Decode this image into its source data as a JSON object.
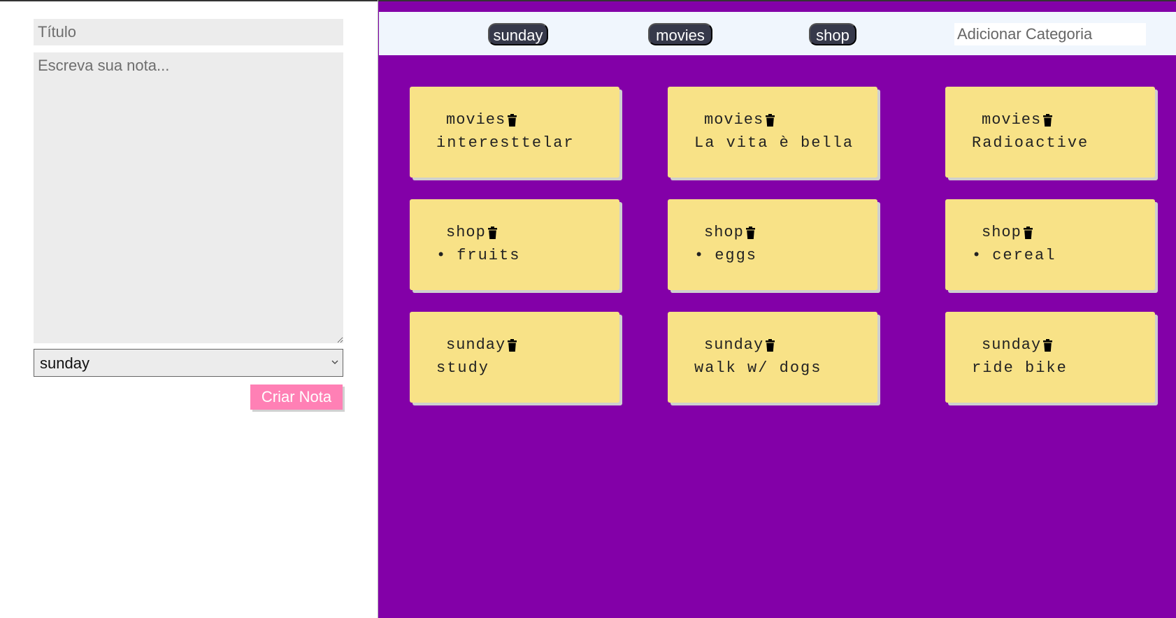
{
  "form": {
    "title_placeholder": "Título",
    "note_placeholder": "Escreva sua nota...",
    "selected_category": "sunday",
    "category_options": [
      "sunday",
      "movies",
      "shop"
    ],
    "create_button_label": "Criar Nota"
  },
  "category_bar": {
    "categories": [
      "sunday",
      "movies",
      "shop"
    ],
    "add_placeholder": "Adicionar Categoria"
  },
  "notes": [
    {
      "category": "movies",
      "text": "interesttelar",
      "bullet": false
    },
    {
      "category": "movies",
      "text": "La vita è bella",
      "bullet": false
    },
    {
      "category": "movies",
      "text": "Radioactive",
      "bullet": false
    },
    {
      "category": "shop",
      "text": "fruits",
      "bullet": true
    },
    {
      "category": "shop",
      "text": "eggs",
      "bullet": true
    },
    {
      "category": "shop",
      "text": "cereal",
      "bullet": true
    },
    {
      "category": "sunday",
      "text": "study",
      "bullet": false
    },
    {
      "category": "sunday",
      "text": "walk w/ dogs",
      "bullet": false
    },
    {
      "category": "sunday",
      "text": "ride bike",
      "bullet": false
    }
  ],
  "icons": {
    "delete": "trash-icon",
    "select": "chevron-down-icon"
  },
  "colors": {
    "board_background": "#8300a8",
    "category_bar_background": "#f0f6fd",
    "category_pill": "#36394a",
    "note_background": "#f8e287",
    "create_button": "#ff80b5",
    "field_background": "#ececec"
  }
}
